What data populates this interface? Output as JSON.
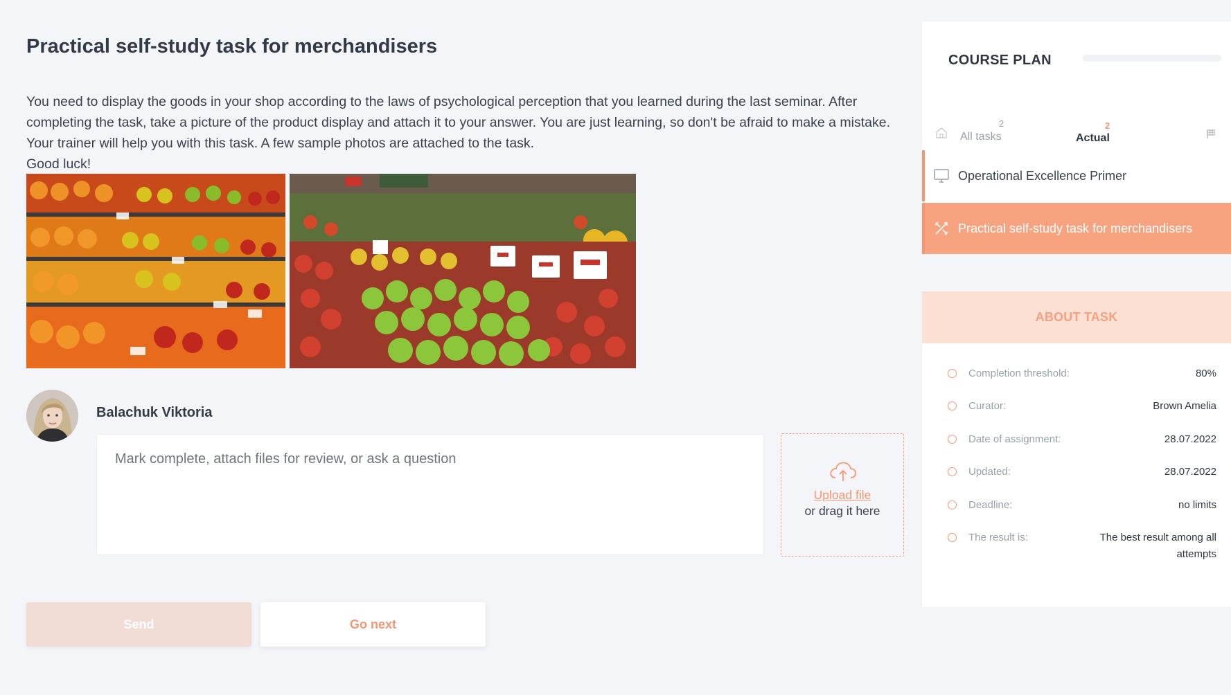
{
  "main": {
    "title": "Practical self-study task for merchandisers",
    "description": [
      "You need to display the goods in your shop according to the laws of psychological perception that you learned during the last seminar. After completing the task, take a picture of the product display and attach it to your answer. You are just learning, so don't be afraid to make a mistake. Your trainer will help you with this task. A few sample photos are attached to the task.",
      "Good luck!"
    ],
    "photos": [
      {
        "alt": "fruit-shelves-photo"
      },
      {
        "alt": "apple-display-photo"
      }
    ]
  },
  "answer": {
    "author_name": "Balachuk Viktoria",
    "comment_placeholder": "Mark complete, attach files for review, or ask a question",
    "upload_link": "Upload file",
    "upload_hint": "or drag it here"
  },
  "buttons": {
    "send": "Send",
    "go_next": "Go next"
  },
  "course_plan": {
    "title": "COURSE PLAN",
    "tabs": {
      "all": {
        "label": "All tasks",
        "count": "2"
      },
      "actual": {
        "label": "Actual",
        "count": "2"
      }
    },
    "items": [
      {
        "label": "Operational Excellence Primer",
        "icon": "monitor-icon"
      },
      {
        "label": "Practical self-study task for merchandisers",
        "icon": "tools-icon",
        "active": true
      }
    ]
  },
  "about_task": {
    "title": "ABOUT TASK",
    "rows": [
      {
        "key": "Completion threshold:",
        "value": "80%"
      },
      {
        "key": "Curator:",
        "value": "Brown Amelia"
      },
      {
        "key": "Date of assignment:",
        "value": "28.07.2022"
      },
      {
        "key": "Updated:",
        "value": "28.07.2022"
      },
      {
        "key": "Deadline:",
        "value": "no limits"
      },
      {
        "key": "The result is:",
        "value": "The best result among all attempts"
      }
    ]
  },
  "colors": {
    "accent": "#f59672",
    "accent_light": "#fde0d4",
    "active_item": "#f8a37f",
    "send_disabled": "#f2ddd6"
  }
}
